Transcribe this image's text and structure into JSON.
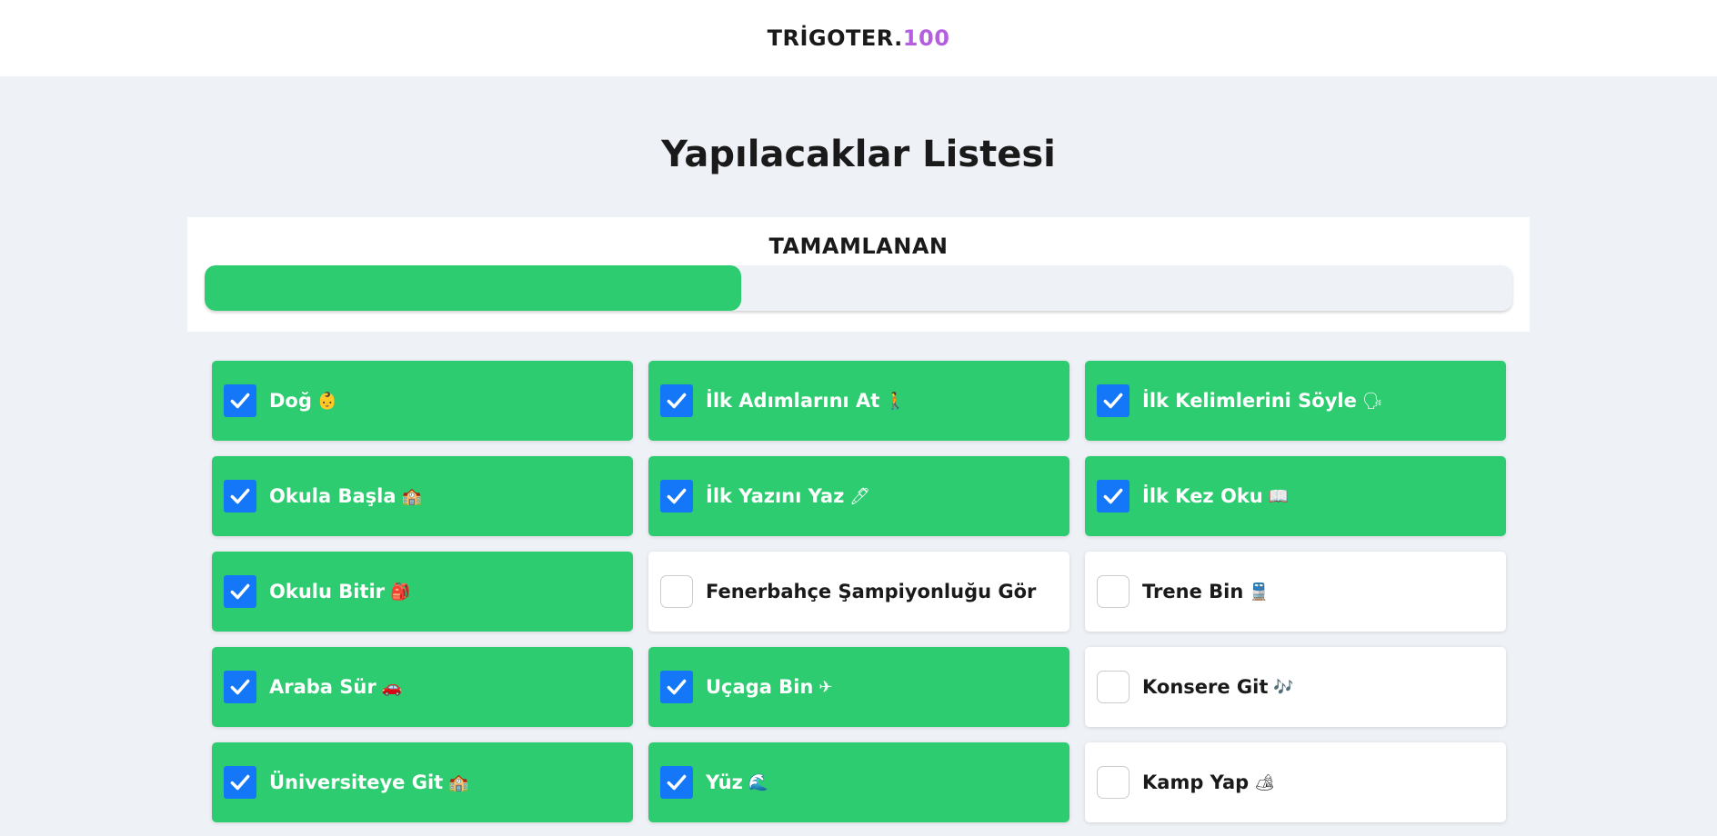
{
  "header": {
    "brand_main": "TRİGOTER.",
    "brand_accent": "100"
  },
  "page": {
    "title": "Yapılacaklar Listesi"
  },
  "progress": {
    "label": "TAMAMLANAN",
    "fraction": 0.41
  },
  "colors": {
    "done": "#2ecc71",
    "checkbox": "#1477f8",
    "accent": "#b45fe0"
  },
  "items": [
    {
      "label": "Doğ",
      "emoji": "👶",
      "done": true
    },
    {
      "label": "İlk Adımlarını At",
      "emoji": "🚶",
      "done": true
    },
    {
      "label": "İlk Kelimlerini Söyle",
      "emoji": "🗣",
      "done": true
    },
    {
      "label": "Okula Başla",
      "emoji": "🏫",
      "done": true
    },
    {
      "label": "İlk Yazını Yaz",
      "emoji": "🖊",
      "done": true
    },
    {
      "label": "İlk Kez Oku",
      "emoji": "📖",
      "done": true
    },
    {
      "label": "Okulu Bitir",
      "emoji": "🎒",
      "done": true
    },
    {
      "label": "Fenerbahçe Şampiyonluğu Gör",
      "emoji": "",
      "done": false
    },
    {
      "label": "Trene Bin",
      "emoji": "🚆",
      "done": false
    },
    {
      "label": "Araba Sür",
      "emoji": "🚗",
      "done": true
    },
    {
      "label": "Uçaga Bin",
      "emoji": "✈",
      "done": true
    },
    {
      "label": "Konsere Git",
      "emoji": "🎶",
      "done": false
    },
    {
      "label": "Üniversiteye Git",
      "emoji": "🏫",
      "done": true
    },
    {
      "label": "Yüz",
      "emoji": "🌊",
      "done": true
    },
    {
      "label": "Kamp Yap",
      "emoji": "🏕",
      "done": false
    }
  ]
}
